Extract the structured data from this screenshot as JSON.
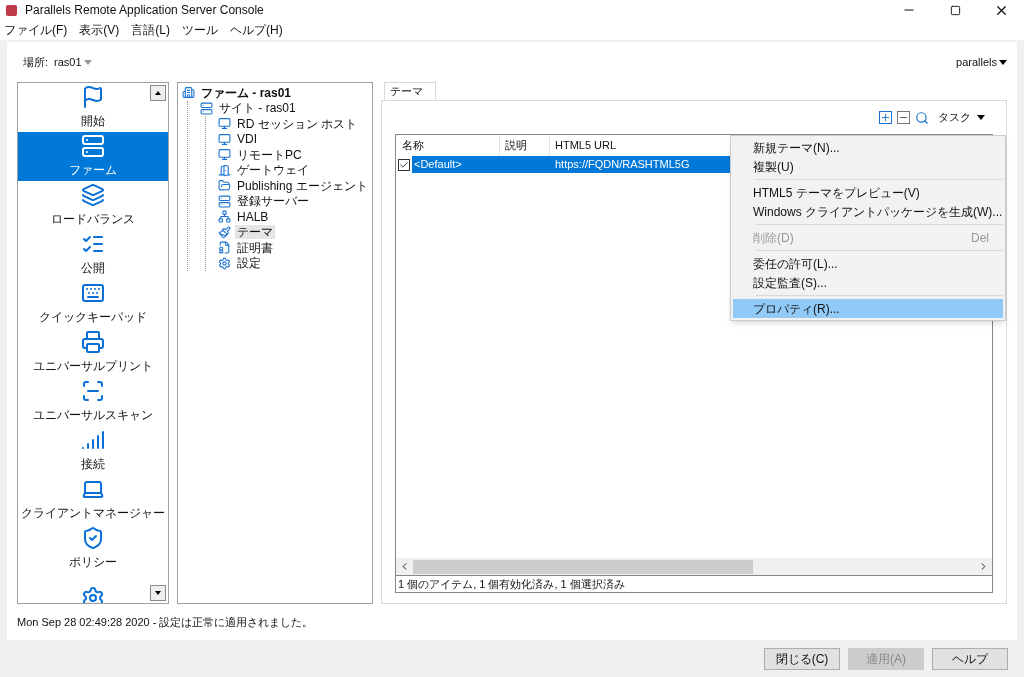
{
  "window": {
    "title": "Parallels Remote Application Server Console"
  },
  "menubar": [
    "ファイル(F)",
    "表示(V)",
    "言語(L)",
    "ツール",
    "ヘルプ(H)"
  ],
  "location": {
    "label": "場所:",
    "value": "ras01"
  },
  "user_menu": "parallels",
  "nav": [
    {
      "label": "開始",
      "selected": false
    },
    {
      "label": "ファーム",
      "selected": true
    },
    {
      "label": "ロードバランス",
      "selected": false
    },
    {
      "label": "公開",
      "selected": false
    },
    {
      "label": "クイックキーパッド",
      "selected": false
    },
    {
      "label": "ユニバーサルプリント",
      "selected": false
    },
    {
      "label": "ユニバーサルスキャン",
      "selected": false
    },
    {
      "label": "接続",
      "selected": false
    },
    {
      "label": "クライアントマネージャー",
      "selected": false
    },
    {
      "label": "ポリシー",
      "selected": false
    },
    {
      "selected": false
    }
  ],
  "tree": [
    {
      "label": "ファーム - ras01",
      "bold": true,
      "selected": false,
      "children": [
        {
          "label": "サイト - ras01",
          "bold": false,
          "selected": false,
          "children": [
            {
              "label": "RD セッション ホスト",
              "bold": false,
              "selected": false
            },
            {
              "label": "VDI",
              "bold": false,
              "selected": false
            },
            {
              "label": "リモートPC",
              "bold": false,
              "selected": false
            },
            {
              "label": "ゲートウェイ",
              "bold": false,
              "selected": false
            },
            {
              "label": "Publishing エージェント",
              "bold": false,
              "selected": false
            },
            {
              "label": "登録サーバー",
              "bold": false,
              "selected": false
            },
            {
              "label": "HALB",
              "bold": false,
              "selected": false
            },
            {
              "label": "テーマ",
              "bold": false,
              "selected": true
            },
            {
              "label": "証明書",
              "bold": false,
              "selected": false
            },
            {
              "label": "設定",
              "bold": false,
              "selected": false
            }
          ]
        }
      ]
    }
  ],
  "tabs": [
    {
      "label": "テーマ",
      "selected": true
    }
  ],
  "toolbar": {
    "tasks": "タスク"
  },
  "table": {
    "columns": [
      "名称",
      "説明",
      "HTML5 URL"
    ],
    "rows": [
      {
        "checked": true,
        "selected": true,
        "cells": [
          "<Default>",
          "",
          "https://FQDN/RASHTML5G"
        ]
      }
    ],
    "footer": "1 個のアイテム, 1 個有効化済み, 1 個選択済み"
  },
  "context_menu": [
    {
      "kind": "item",
      "label": "新規テーマ(N)...",
      "disabled": false,
      "selected": false
    },
    {
      "kind": "item",
      "label": "複製(U)",
      "disabled": false,
      "selected": false
    },
    {
      "kind": "separator"
    },
    {
      "kind": "item",
      "label": "HTML5 テーマをプレビュー(V)",
      "disabled": false,
      "selected": false
    },
    {
      "kind": "item",
      "label": "Windows クライアントパッケージを生成(W)...",
      "disabled": false,
      "selected": false
    },
    {
      "kind": "separator"
    },
    {
      "kind": "item",
      "label": "削除(D)",
      "shortcut": "Del",
      "disabled": true,
      "selected": false
    },
    {
      "kind": "separator"
    },
    {
      "kind": "item",
      "label": "委任の許可(L)...",
      "disabled": false,
      "selected": false
    },
    {
      "kind": "item",
      "label": "設定監査(S)...",
      "disabled": false,
      "selected": false
    },
    {
      "kind": "separator"
    },
    {
      "kind": "item",
      "label": "プロパティ(R)...",
      "disabled": false,
      "selected": true
    }
  ],
  "status_bar": "Mon Sep 28 02:49:28 2020 - 設定は正常に適用されました。",
  "buttons": [
    {
      "label": "閉じる(C)",
      "disabled": false
    },
    {
      "label": "適用(A)",
      "disabled": true
    },
    {
      "label": "ヘルプ",
      "disabled": false
    }
  ]
}
